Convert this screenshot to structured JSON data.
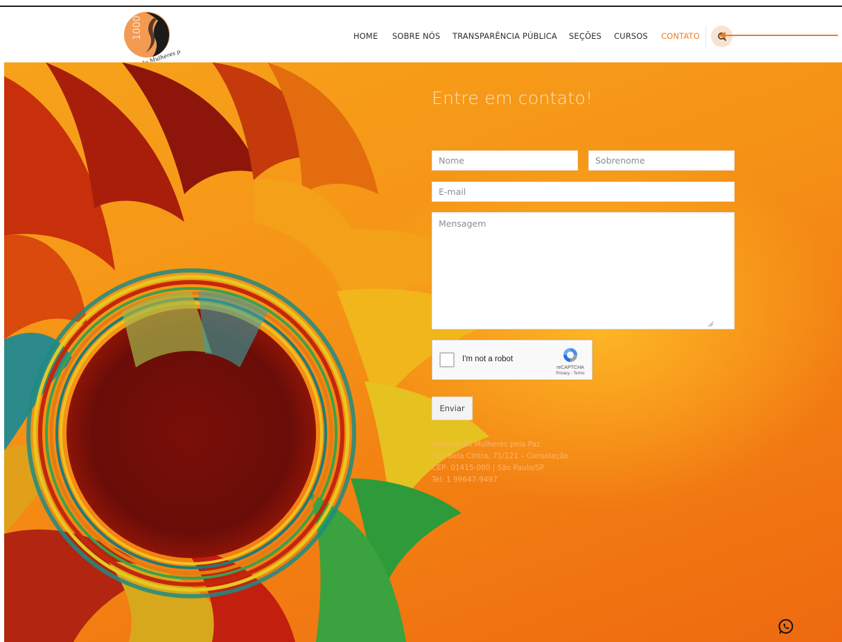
{
  "logo": {
    "number": "1000",
    "text": "Associação Mulheres pela Paz"
  },
  "nav": {
    "items": [
      {
        "label": "HOME",
        "active": false
      },
      {
        "label": "SOBRE NÓS",
        "active": false
      },
      {
        "label": "TRANSPARÊNCIA PÚBLICA",
        "active": false
      },
      {
        "label": "SEÇÕES",
        "active": false
      },
      {
        "label": "CURSOS",
        "active": false
      },
      {
        "label": "CONTATO",
        "active": true
      }
    ],
    "search_icon": "search-icon"
  },
  "form": {
    "heading": "Entre em contato!",
    "first_name_placeholder": "Nome",
    "last_name_placeholder": "Sobrenome",
    "email_placeholder": "E-mail",
    "message_placeholder": "Mensagem",
    "submit_label": "Enviar"
  },
  "captcha": {
    "label": "I'm not a robot",
    "brand": "reCAPTCHA",
    "links": "Privacy - Terms"
  },
  "address": {
    "line1": "Associação Mulheres pela Paz",
    "line2": "Rua Bela Cintra, 71/121 – Consolação",
    "line3": "CEP: 01415-000 | São Paulo/SP",
    "line4": "Tel: 1 99647-9497"
  },
  "colors": {
    "accent": "#f07d22",
    "annotation_arrow": "#f07d22"
  },
  "whatsapp_icon": "whatsapp-icon"
}
